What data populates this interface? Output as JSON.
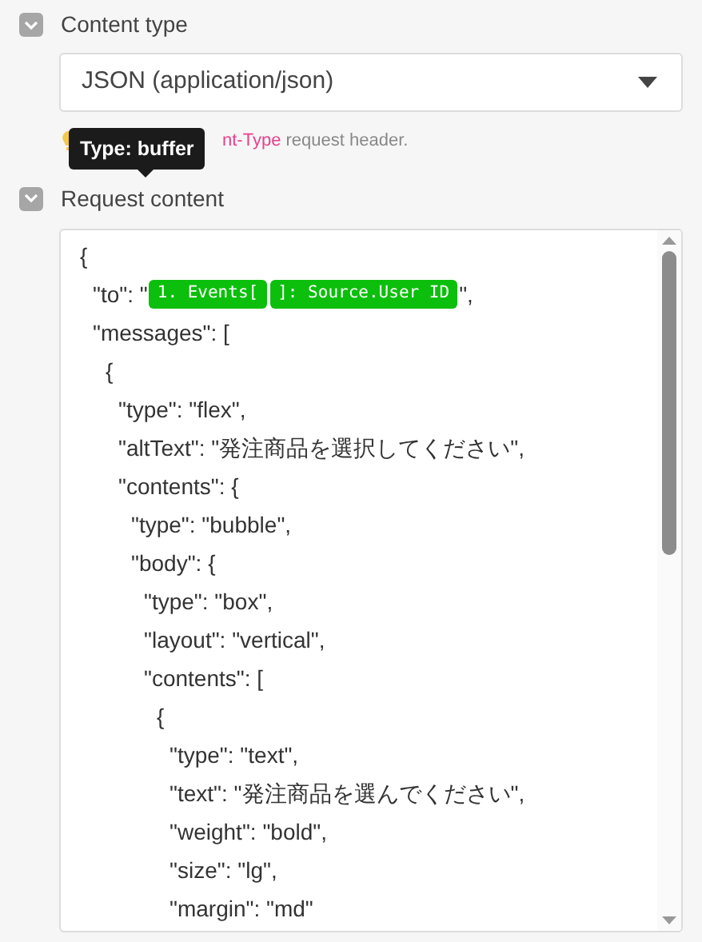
{
  "content_type": {
    "label": "Content type",
    "expanded": true,
    "select": {
      "value": "JSON (application/json)"
    },
    "hint": {
      "highlight": "nt-Type",
      "rest": " request header."
    }
  },
  "tooltip": {
    "text": "Type: buffer"
  },
  "request_content": {
    "label": "Request content",
    "expanded": true,
    "lines": [
      {
        "segments": [
          {
            "kind": "text",
            "text": "{"
          }
        ],
        "children": [
          {
            "segments": [
              {
                "kind": "text",
                "text": "\"to\": \""
              },
              {
                "kind": "pill",
                "text": "1. Events["
              },
              {
                "kind": "pill",
                "text": "]: Source.User ID"
              },
              {
                "kind": "text",
                "text": "\","
              }
            ]
          },
          {
            "segments": [
              {
                "kind": "text",
                "text": "\"messages\": ["
              }
            ],
            "children": [
              {
                "segments": [
                  {
                    "kind": "text",
                    "text": "{"
                  }
                ],
                "children": [
                  {
                    "segments": [
                      {
                        "kind": "text",
                        "text": "\"type\": \"flex\","
                      }
                    ]
                  },
                  {
                    "segments": [
                      {
                        "kind": "text",
                        "text": "\"altText\": \"発注商品を選択してください\","
                      }
                    ]
                  },
                  {
                    "segments": [
                      {
                        "kind": "text",
                        "text": "\"contents\": {"
                      }
                    ],
                    "children": [
                      {
                        "segments": [
                          {
                            "kind": "text",
                            "text": "\"type\": \"bubble\","
                          }
                        ]
                      },
                      {
                        "segments": [
                          {
                            "kind": "text",
                            "text": "\"body\": {"
                          }
                        ],
                        "children": [
                          {
                            "segments": [
                              {
                                "kind": "text",
                                "text": "\"type\": \"box\","
                              }
                            ]
                          },
                          {
                            "segments": [
                              {
                                "kind": "text",
                                "text": "\"layout\": \"vertical\","
                              }
                            ]
                          },
                          {
                            "segments": [
                              {
                                "kind": "text",
                                "text": "\"contents\": ["
                              }
                            ],
                            "children": [
                              {
                                "segments": [
                                  {
                                    "kind": "text",
                                    "text": "{"
                                  }
                                ],
                                "children": [
                                  {
                                    "segments": [
                                      {
                                        "kind": "text",
                                        "text": "\"type\": \"text\","
                                      }
                                    ]
                                  },
                                  {
                                    "segments": [
                                      {
                                        "kind": "text",
                                        "text": "\"text\": \"発注商品を選んでください\","
                                      }
                                    ]
                                  },
                                  {
                                    "segments": [
                                      {
                                        "kind": "text",
                                        "text": "\"weight\": \"bold\","
                                      }
                                    ]
                                  },
                                  {
                                    "segments": [
                                      {
                                        "kind": "text",
                                        "text": "\"size\": \"lg\","
                                      }
                                    ]
                                  },
                                  {
                                    "segments": [
                                      {
                                        "kind": "text",
                                        "text": "\"margin\": \"md\""
                                      }
                                    ]
                                  }
                                ]
                              }
                            ]
                          }
                        ]
                      }
                    ]
                  }
                ]
              }
            ]
          }
        ]
      }
    ]
  }
}
